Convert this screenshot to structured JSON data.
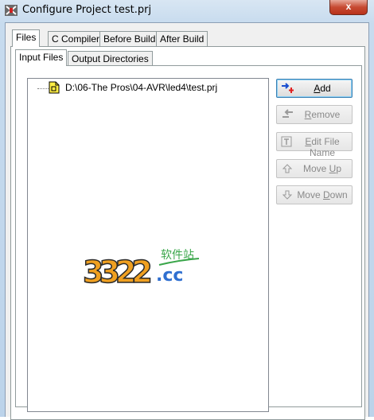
{
  "window": {
    "title": "Configure Project test.prj",
    "close_glyph": "x"
  },
  "tabs": [
    {
      "label": "Files",
      "active": true
    },
    {
      "label": "C Compiler",
      "active": false
    },
    {
      "label": "Before Build",
      "active": false
    },
    {
      "label": "After Build",
      "active": false
    }
  ],
  "inner_tabs": [
    {
      "label": "Input Files",
      "active": true
    },
    {
      "label": "Output Directories",
      "active": false
    }
  ],
  "tree": {
    "items": [
      {
        "label": "D:\\06-The Pros\\04-AVR\\led4\\test.prj",
        "icon": "project-file-icon"
      }
    ]
  },
  "buttons": {
    "add": {
      "pre": "",
      "key": "A",
      "post": "dd",
      "enabled": true,
      "icon": "add-icon"
    },
    "remove": {
      "pre": "",
      "key": "R",
      "post": "emove",
      "enabled": false,
      "icon": "remove-icon"
    },
    "edit": {
      "pre": "",
      "key": "E",
      "post": "dit File Name",
      "enabled": false,
      "icon": "edit-icon"
    },
    "move_up": {
      "pre": "Move ",
      "key": "U",
      "post": "p",
      "enabled": false,
      "icon": "arrow-up-icon"
    },
    "move_down": {
      "pre": "Move ",
      "key": "D",
      "post": "own",
      "enabled": false,
      "icon": "arrow-down-icon"
    }
  },
  "watermark": {
    "digits": "3322",
    "suffix": ".cc",
    "chinese": "软件站"
  },
  "colors": {
    "titlebar": "#c7dbee",
    "close": "#c74a32",
    "watermark_orange": "#f0a020",
    "watermark_green": "#3aa64a",
    "watermark_blue": "#2f6fd0"
  }
}
